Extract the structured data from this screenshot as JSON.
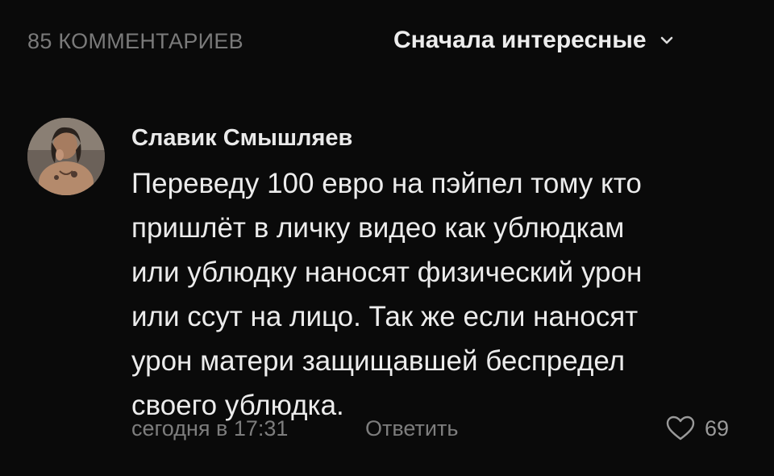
{
  "header": {
    "comments_count_label": "85 КОММЕНТАРИЕВ",
    "sort_label": "Сначала интересные",
    "sort_icon": "chevron-down-icon"
  },
  "comment": {
    "author": "Славик Смышляев",
    "text": "Переведу 100 евро на пэйпел тому кто\nпришлёт в личку видео как ублюдкам\nили ублюдку наносят физический урон\nили ссут на лицо. Так же если наносят\nурон матери защищавшей беспредел\nсвоего ублюдка.",
    "timestamp": "сегодня в 17:31",
    "reply_label": "Ответить",
    "likes": "69",
    "like_icon": "heart-icon"
  },
  "colors": {
    "background": "#0a0a0a",
    "primary_text": "#ececec",
    "secondary_text": "#7d7d7d"
  }
}
